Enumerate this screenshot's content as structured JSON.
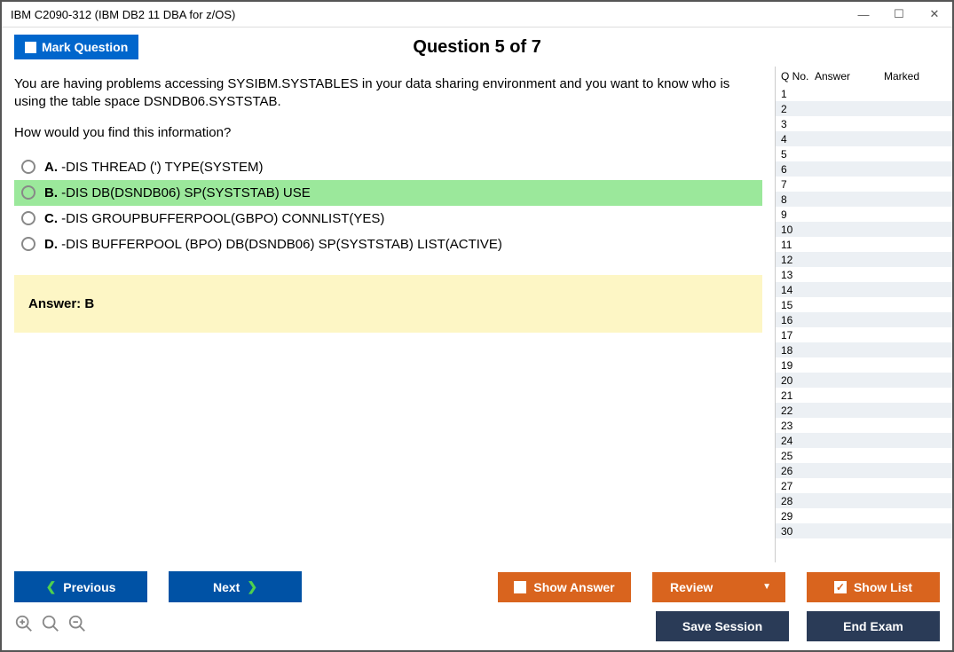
{
  "window": {
    "title": "IBM C2090-312 (IBM DB2 11 DBA for z/OS)"
  },
  "header": {
    "mark_label": "Mark Question",
    "counter": "Question 5 of 7"
  },
  "question": {
    "text_line1": "You are having problems accessing SYSIBM.SYSTABLES in your data sharing environment and you want to know who is using the table space DSNDB06.SYSTSTAB.",
    "text_line2": "How would you find this information?",
    "options": [
      {
        "letter": "A.",
        "text": "-DIS THREAD (') TYPE(SYSTEM)",
        "correct": false
      },
      {
        "letter": "B.",
        "text": "-DIS DB(DSNDB06) SP(SYSTSTAB) USE",
        "correct": true
      },
      {
        "letter": "C.",
        "text": "-DIS GROUPBUFFERPOOL(GBPO) CONNLIST(YES)",
        "correct": false
      },
      {
        "letter": "D.",
        "text": "-DIS BUFFERPOOL (BPO) DB(DSNDB06) SP(SYSTSTAB) LIST(ACTIVE)",
        "correct": false
      }
    ],
    "answer_label": "Answer: B"
  },
  "sidebar": {
    "col1": "Q No.",
    "col2": "Answer",
    "col3": "Marked",
    "row_count": 30
  },
  "footer": {
    "previous": "Previous",
    "next": "Next",
    "show_answer": "Show Answer",
    "review": "Review",
    "show_list": "Show List",
    "save_session": "Save Session",
    "end_exam": "End Exam"
  }
}
